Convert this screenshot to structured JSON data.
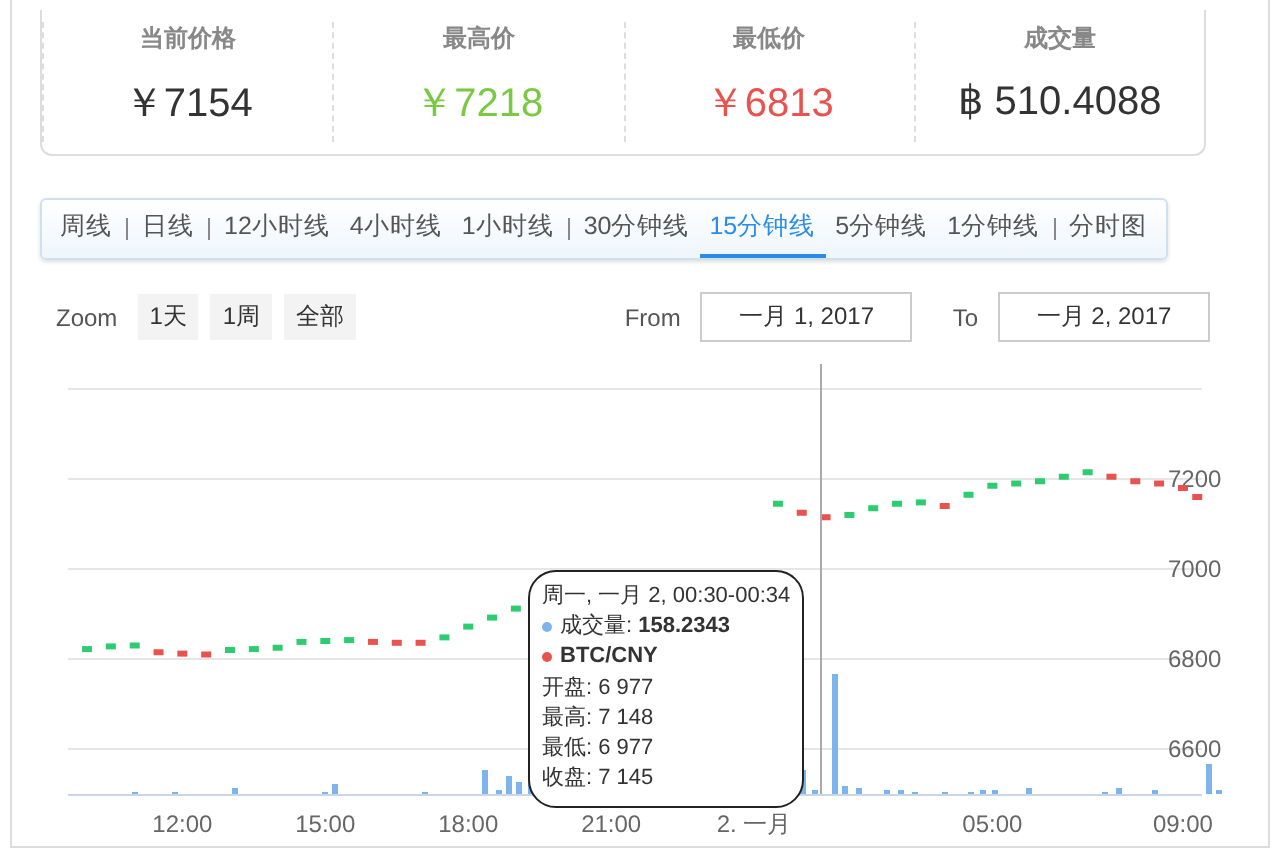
{
  "stats": [
    {
      "label": "当前价格",
      "value": "￥7154",
      "color": "#333333"
    },
    {
      "label": "最高价",
      "value": "￥7218",
      "color": "#7ac943"
    },
    {
      "label": "最低价",
      "value": "￥6813",
      "color": "#e9534f"
    },
    {
      "label": "成交量",
      "value": "฿ 510.4088",
      "color": "#333333"
    }
  ],
  "tabs": [
    {
      "label": "周线",
      "selected": false,
      "separator_after": true
    },
    {
      "label": "日线",
      "selected": false,
      "separator_after": true
    },
    {
      "label": "12小时线",
      "selected": false,
      "separator_after": false
    },
    {
      "label": "4小时线",
      "selected": false,
      "separator_after": false
    },
    {
      "label": "1小时线",
      "selected": false,
      "separator_after": true
    },
    {
      "label": "30分钟线",
      "selected": false,
      "separator_after": false
    },
    {
      "label": "15分钟线",
      "selected": true,
      "separator_after": false
    },
    {
      "label": "5分钟线",
      "selected": false,
      "separator_after": false
    },
    {
      "label": "1分钟线",
      "selected": false,
      "separator_after": true
    },
    {
      "label": "分时图",
      "selected": false,
      "separator_after": false
    }
  ],
  "zoom": {
    "label": "Zoom",
    "buttons": [
      "1天",
      "1周",
      "全部"
    ]
  },
  "range": {
    "from_label": "From",
    "from": "一月 1, 2017",
    "to_label": "To",
    "to": "一月 2, 2017"
  },
  "chart": {
    "chart_data": {
      "type": "scatter",
      "grid": true,
      "xlim": [
        9.6,
        33.4
      ],
      "ylim": [
        6500,
        7400
      ],
      "yticks": [
        6600,
        6800,
        7000,
        7200
      ],
      "xticks": [
        {
          "value": 12,
          "label": "12:00"
        },
        {
          "value": 15,
          "label": "15:00"
        },
        {
          "value": 18,
          "label": "18:00"
        },
        {
          "value": 21,
          "label": "21:00"
        }
      ],
      "x": [
        10,
        10.5,
        11,
        11.5,
        12,
        12.5,
        13,
        13.5,
        14,
        14.5,
        15,
        15.5,
        16,
        16.5,
        17,
        17.5,
        18,
        18.5,
        19,
        24.5,
        25,
        25.5,
        26,
        26.5,
        27,
        27.5,
        28,
        28.5,
        29,
        29.5,
        30,
        30.5,
        31,
        31.5,
        32,
        32.5,
        33,
        33.3
      ],
      "series": [
        {
          "name": "BTC/CNY",
          "color": "#e9534f",
          "values": [
            null,
            null,
            null,
            6815,
            6812,
            6810,
            null,
            null,
            null,
            null,
            null,
            null,
            6838,
            6836,
            6836,
            null,
            null,
            null,
            null,
            null,
            7125,
            7115,
            null,
            null,
            null,
            null,
            7140,
            null,
            null,
            null,
            null,
            null,
            null,
            7205,
            7195,
            7190,
            7180,
            7160
          ]
        },
        {
          "color": "#2ecc71",
          "values": [
            6822,
            6828,
            6830,
            null,
            null,
            null,
            6820,
            6822,
            6825,
            6838,
            6840,
            6842,
            null,
            null,
            null,
            6848,
            6872,
            6892,
            6912,
            7145,
            null,
            null,
            7120,
            7135,
            7145,
            7148,
            null,
            7165,
            7185,
            7190,
            7195,
            7205,
            7215,
            null,
            null,
            null,
            null,
            null
          ]
        }
      ]
    },
    "next_day_x_labels": [
      "2. 一月",
      "05:00",
      "09:00"
    ],
    "tooltip": {
      "title": "周一, 一月 2, 00:30-00:34",
      "series": [
        {
          "kind": "volume",
          "text": "成交量: **158.2343**",
          "color": "#7cb5ec"
        },
        {
          "kind": "price",
          "color": "#e9534f"
        }
      ],
      "lines": [
        "开盘: 6 977",
        "最高: 7 148",
        "最低: 6 977",
        "收盘: 7 145"
      ]
    }
  }
}
